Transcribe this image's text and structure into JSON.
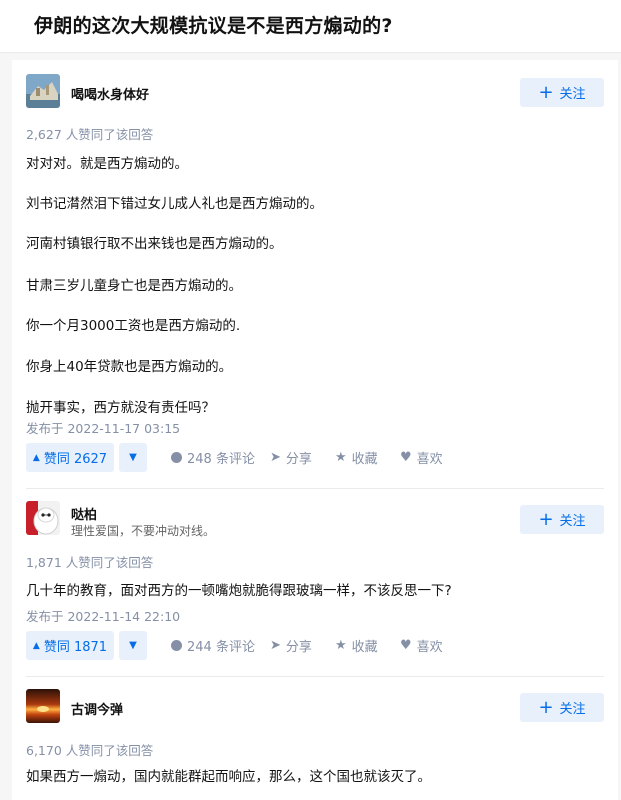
{
  "question": {
    "title": "伊朗的这次大规模抗议是不是西方煽动的?"
  },
  "answers": [
    {
      "author": {
        "name": "喝喝水身体好",
        "bio": ""
      },
      "follow_label": "关注",
      "voters": "2,627 人赞同了该回答",
      "paragraphs": [
        "对对对。就是西方煽动的。",
        "刘书记潸然泪下错过女儿成人礼也是西方煽动的。",
        "河南村镇银行取不出来钱也是西方煽动的。",
        "甘肃三岁儿童身亡也是西方煽动的。",
        "你一个月3000工资也是西方煽动的.",
        "你身上40年贷款也是西方煽动的。",
        "抛开事实，西方就没有责任吗？"
      ],
      "published": "发布于 2022-11-17 03:15",
      "vote_label": "赞同 2627",
      "comments": "248 条评论",
      "share": "分享",
      "collect": "收藏",
      "like": "喜欢"
    },
    {
      "author": {
        "name": "哒柏",
        "bio": "理性爱国，不要冲动对线。"
      },
      "follow_label": "关注",
      "voters": "1,871 人赞同了该回答",
      "paragraphs": [
        "几十年的教育，面对西方的一顿嘴炮就脆得跟玻璃一样，不该反思一下?"
      ],
      "published": "发布于 2022-11-14 22:10",
      "vote_label": "赞同 1871",
      "comments": "244 条评论",
      "share": "分享",
      "collect": "收藏",
      "like": "喜欢"
    },
    {
      "author": {
        "name": "古调今弹",
        "bio": ""
      },
      "follow_label": "关注",
      "voters": "6,170 人赞同了该回答",
      "paragraphs": [
        "如果西方一煽动，国内就能群起而响应，那么，这个国也就该灭了。"
      ]
    }
  ],
  "colors": {
    "accent": "#056de8",
    "accent_bg": "#e8f0fc",
    "meta": "#8590a6"
  },
  "icons": {
    "follow": "plus-icon",
    "vote_up": "triangle-up-icon",
    "vote_down": "triangle-down-icon",
    "comment": "comment-bubble-icon",
    "share": "share-arrow-icon",
    "collect": "star-icon",
    "like": "heart-icon"
  }
}
